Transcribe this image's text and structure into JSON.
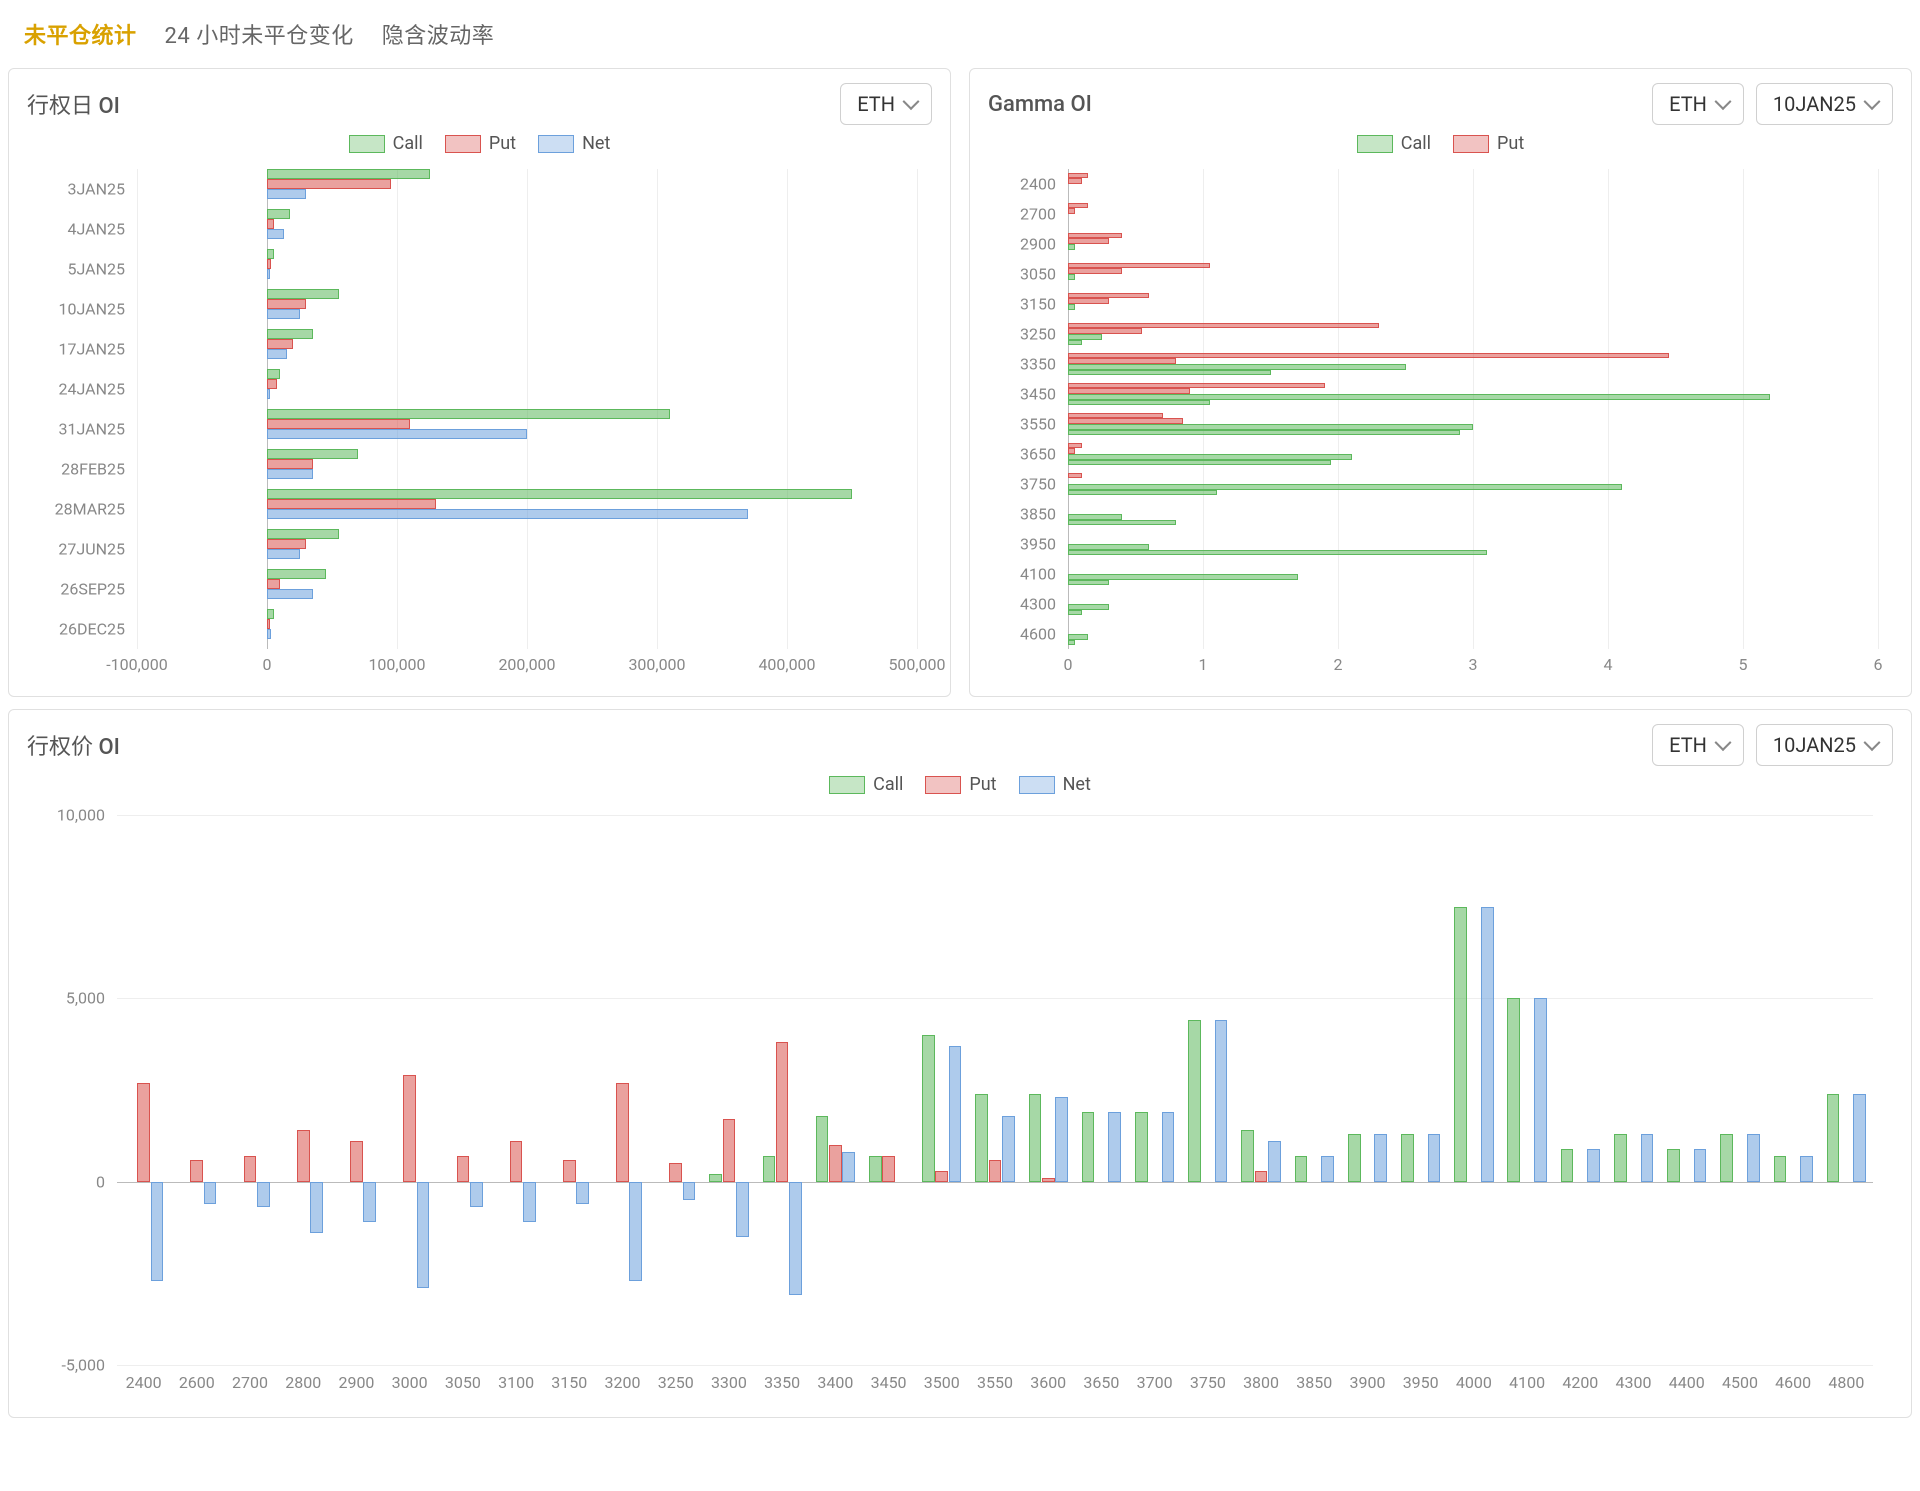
{
  "tabs": {
    "items": [
      {
        "label": "未平仓统计",
        "active": true
      },
      {
        "label": "24 小时未平仓变化",
        "active": false
      },
      {
        "label": "隐含波动率",
        "active": false
      }
    ]
  },
  "colors": {
    "call": "#5cb85c",
    "put": "#d9534f",
    "net": "#6ca0dc"
  },
  "expiry_card": {
    "title": "行权日 OI",
    "asset": "ETH",
    "legend": {
      "call": "Call",
      "put": "Put",
      "net": "Net"
    }
  },
  "gamma_card": {
    "title": "Gamma OI",
    "asset": "ETH",
    "date": "10JAN25",
    "legend": {
      "call": "Call",
      "put": "Put"
    }
  },
  "strike_card": {
    "title": "行权价 OI",
    "asset": "ETH",
    "date": "10JAN25",
    "legend": {
      "call": "Call",
      "put": "Put",
      "net": "Net"
    }
  },
  "chart_data": [
    {
      "id": "expiry_oi",
      "type": "bar",
      "orientation": "horizontal",
      "title": "行权日 OI",
      "xlabel": "",
      "ylabel": "",
      "xlim": [
        -100000,
        500000
      ],
      "xticks": [
        -100000,
        0,
        100000,
        200000,
        300000,
        400000,
        500000
      ],
      "xtick_labels": [
        "-100,000",
        "0",
        "100,000",
        "200,000",
        "300,000",
        "400,000",
        "500,000"
      ],
      "categories": [
        "3JAN25",
        "4JAN25",
        "5JAN25",
        "10JAN25",
        "17JAN25",
        "24JAN25",
        "31JAN25",
        "28FEB25",
        "28MAR25",
        "27JUN25",
        "26SEP25",
        "26DEC25"
      ],
      "series": [
        {
          "name": "Call",
          "values": [
            125000,
            18000,
            5000,
            55000,
            35000,
            10000,
            310000,
            70000,
            450000,
            55000,
            45000,
            5000
          ]
        },
        {
          "name": "Put",
          "values": [
            95000,
            5000,
            3000,
            30000,
            20000,
            8000,
            110000,
            35000,
            130000,
            30000,
            10000,
            2000
          ]
        },
        {
          "name": "Net",
          "values": [
            30000,
            13000,
            2000,
            25000,
            15000,
            2000,
            200000,
            35000,
            370000,
            25000,
            35000,
            3000
          ]
        }
      ]
    },
    {
      "id": "gamma_oi",
      "type": "bar",
      "orientation": "horizontal",
      "title": "Gamma OI",
      "xlabel": "",
      "ylabel": "",
      "xlim": [
        0,
        6
      ],
      "xticks": [
        0,
        1,
        2,
        3,
        4,
        5,
        6
      ],
      "categories": [
        "2400",
        "2700",
        "2900",
        "3050",
        "3150",
        "3250",
        "3350",
        "3450",
        "3550",
        "3650",
        "3750",
        "3850",
        "3950",
        "4100",
        "4300",
        "4600"
      ],
      "series": [
        {
          "name": "Call",
          "values": [
            0.0,
            0.0,
            0.05,
            0.05,
            0.05,
            0.25,
            2.5,
            5.2,
            3.0,
            2.1,
            4.1,
            0.4,
            0.6,
            1.7,
            0.3,
            0.15
          ],
          "secondary": [
            0.0,
            0.0,
            0.0,
            0.0,
            0.0,
            0.1,
            1.5,
            1.05,
            2.9,
            1.95,
            1.1,
            0.8,
            3.1,
            0.3,
            0.1,
            0.05
          ]
        },
        {
          "name": "Put",
          "values": [
            0.15,
            0.15,
            0.4,
            1.05,
            0.6,
            2.3,
            4.45,
            1.9,
            0.7,
            0.1,
            0.1,
            0.0,
            0.0,
            0.0,
            0.0,
            0.0
          ],
          "secondary": [
            0.1,
            0.05,
            0.3,
            0.4,
            0.3,
            0.55,
            0.8,
            0.9,
            0.85,
            0.05,
            0.0,
            0.0,
            0.0,
            0.0,
            0.0,
            0.0
          ]
        }
      ],
      "note": "Each strike row shows two Call (green) + two Put (red) thin bars; values[] is the upper bar of the pair, secondary[] is the lower bar."
    },
    {
      "id": "strike_oi",
      "type": "bar",
      "orientation": "vertical",
      "title": "行权价 OI",
      "xlabel": "",
      "ylabel": "",
      "ylim": [
        -5000,
        10000
      ],
      "yticks": [
        -5000,
        0,
        5000,
        10000
      ],
      "ytick_labels": [
        "-5,000",
        "0",
        "5,000",
        "10,000"
      ],
      "categories": [
        "2400",
        "2600",
        "2700",
        "2800",
        "2900",
        "3000",
        "3050",
        "3100",
        "3150",
        "3200",
        "3250",
        "3300",
        "3350",
        "3400",
        "3450",
        "3500",
        "3550",
        "3600",
        "3650",
        "3700",
        "3750",
        "3800",
        "3850",
        "3900",
        "3950",
        "4000",
        "4100",
        "4200",
        "4300",
        "4400",
        "4500",
        "4600",
        "4800"
      ],
      "series": [
        {
          "name": "Call",
          "values": [
            0,
            0,
            0,
            0,
            0,
            0,
            0,
            0,
            0,
            0,
            0,
            200,
            700,
            1800,
            700,
            4000,
            2400,
            2400,
            1900,
            1900,
            4400,
            1400,
            700,
            1300,
            1300,
            7500,
            5000,
            900,
            1300,
            900,
            1300,
            700,
            2400
          ]
        },
        {
          "name": "Put",
          "values": [
            2700,
            600,
            700,
            1400,
            1100,
            2900,
            700,
            1100,
            600,
            2700,
            500,
            1700,
            3800,
            1000,
            700,
            300,
            600,
            100,
            0,
            0,
            0,
            300,
            0,
            0,
            0,
            0,
            0,
            0,
            0,
            0,
            0,
            0,
            0
          ]
        },
        {
          "name": "Net",
          "values": [
            -2700,
            -600,
            -700,
            -1400,
            -1100,
            -2900,
            -700,
            -1100,
            -600,
            -2700,
            -500,
            -1500,
            -3100,
            800,
            0,
            3700,
            1800,
            2300,
            1900,
            1900,
            4400,
            1100,
            700,
            1300,
            1300,
            7500,
            5000,
            900,
            1300,
            900,
            1300,
            700,
            2400
          ]
        }
      ]
    }
  ]
}
